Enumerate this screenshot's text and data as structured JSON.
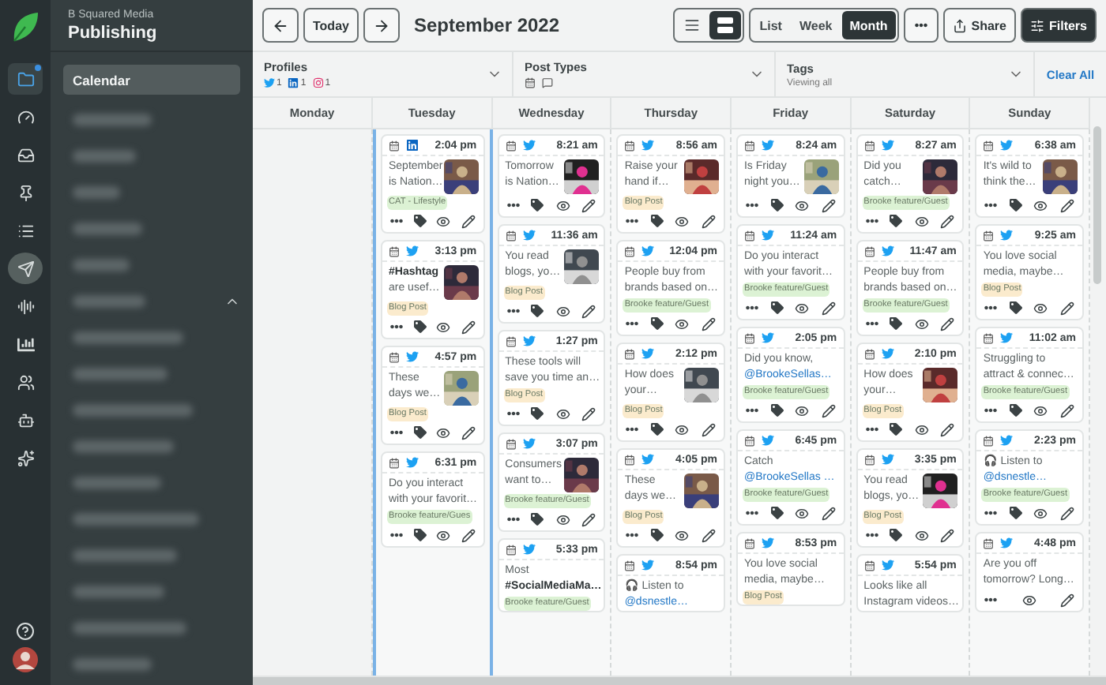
{
  "rail": [
    {
      "kind": "folder",
      "selected": false,
      "badge": true
    },
    {
      "kind": "gauge",
      "selected": false,
      "badge": false
    },
    {
      "kind": "inbox",
      "selected": false,
      "badge": false
    },
    {
      "kind": "pin",
      "selected": false,
      "badge": false
    },
    {
      "kind": "list",
      "selected": false,
      "badge": false
    },
    {
      "kind": "send",
      "selected": true,
      "badge": false
    },
    {
      "kind": "waveform",
      "selected": false,
      "badge": false
    },
    {
      "kind": "chart",
      "selected": false,
      "badge": false
    },
    {
      "kind": "users",
      "selected": false,
      "badge": false
    },
    {
      "kind": "bot",
      "selected": false,
      "badge": false
    },
    {
      "kind": "sparkles",
      "selected": false,
      "badge": false
    }
  ],
  "rail_bottom": [
    {
      "kind": "help"
    },
    {
      "kind": "avatar"
    }
  ],
  "nav": {
    "org": "B Squared Media",
    "section": "Publishing",
    "items": [
      {
        "label": "Calendar",
        "selected": true
      }
    ]
  },
  "toolbar": {
    "today": "Today",
    "title": "September 2022",
    "layouts": [
      {
        "kind": "list",
        "selected": false
      },
      {
        "kind": "grid",
        "selected": true
      }
    ],
    "views": [
      {
        "label": "List",
        "selected": false
      },
      {
        "label": "Week",
        "selected": false
      },
      {
        "label": "Month",
        "selected": true
      }
    ],
    "share": "Share",
    "filters": "Filters"
  },
  "filters": {
    "profiles": {
      "label": "Profiles",
      "networks": [
        {
          "kind": "twitter",
          "count": "1"
        },
        {
          "kind": "linkedin",
          "count": "1"
        },
        {
          "kind": "instagram",
          "count": "1"
        }
      ]
    },
    "post_types": {
      "label": "Post Types"
    },
    "tags": {
      "label": "Tags",
      "value": "Viewing all"
    },
    "clear": "Clear All"
  },
  "days": [
    {
      "name": "Monday",
      "selected": false
    },
    {
      "name": "Tuesday",
      "selected": true,
      "posts": [
        {
          "kind": "linkedin",
          "time": "2:04 pm",
          "lines": [
            {
              "kind": "plain",
              "text": "September"
            },
            {
              "kind": "plain",
              "text": "is Nation…"
            }
          ],
          "picture": true,
          "tag": {
            "label": "CAT - Lifestyle",
            "color": "#dcf2d4"
          },
          "actions": [
            {
              "kind": "more"
            },
            {
              "kind": "tag"
            },
            {
              "kind": "preview"
            },
            {
              "kind": "edit"
            }
          ]
        },
        {
          "kind": "twitter",
          "time": "3:13 pm",
          "lines": [
            {
              "kind": "hashtag",
              "text": "#Hashtag"
            },
            {
              "kind": "plain",
              "text": "are usef…"
            }
          ],
          "picture": true,
          "tag": {
            "label": "Blog Post",
            "color": "#fbebcd"
          },
          "actions": [
            {
              "kind": "more"
            },
            {
              "kind": "tag"
            },
            {
              "kind": "preview"
            },
            {
              "kind": "edit"
            }
          ]
        },
        {
          "kind": "twitter",
          "time": "4:57 pm",
          "lines": [
            {
              "kind": "plain",
              "text": "These"
            },
            {
              "kind": "plain",
              "text": "days we…"
            }
          ],
          "picture": true,
          "tag": {
            "label": "Blog Post",
            "color": "#fbebcd"
          },
          "actions": [
            {
              "kind": "more"
            },
            {
              "kind": "tag"
            },
            {
              "kind": "preview"
            },
            {
              "kind": "edit"
            }
          ]
        },
        {
          "kind": "twitter",
          "time": "6:31 pm",
          "lines": [
            {
              "kind": "plain",
              "text": "Do you interact"
            },
            {
              "kind": "plain",
              "text": "with your favorit…"
            }
          ],
          "picture": false,
          "tag": {
            "label": "Brooke feature/Gues",
            "color": "#dcf2d4"
          },
          "actions": [
            {
              "kind": "more"
            },
            {
              "kind": "tag"
            },
            {
              "kind": "preview"
            },
            {
              "kind": "edit"
            }
          ]
        }
      ]
    },
    {
      "name": "Wednesday",
      "selected": false,
      "posts": [
        {
          "kind": "twitter",
          "time": "8:21 am",
          "lines": [
            {
              "kind": "plain",
              "text": "Tomorrow"
            },
            {
              "kind": "plain",
              "text": "is Nation…"
            }
          ],
          "picture": true,
          "actions": [
            {
              "kind": "more"
            },
            {
              "kind": "tag"
            },
            {
              "kind": "preview"
            },
            {
              "kind": "edit"
            }
          ]
        },
        {
          "kind": "twitter",
          "time": "11:36 am",
          "lines": [
            {
              "kind": "plain",
              "text": "You read"
            },
            {
              "kind": "plain",
              "text": "blogs, yo…"
            }
          ],
          "picture": true,
          "tag": {
            "label": "Blog Post",
            "color": "#fbebcd"
          },
          "actions": [
            {
              "kind": "more"
            },
            {
              "kind": "tag"
            },
            {
              "kind": "preview"
            },
            {
              "kind": "edit"
            }
          ]
        },
        {
          "kind": "twitter",
          "time": "1:27 pm",
          "lines": [
            {
              "kind": "plain",
              "text": "These tools will"
            },
            {
              "kind": "plain",
              "text": "save you time an…"
            }
          ],
          "picture": false,
          "tag": {
            "label": "Blog Post",
            "color": "#fbebcd"
          },
          "actions": [
            {
              "kind": "more"
            },
            {
              "kind": "tag"
            },
            {
              "kind": "preview"
            },
            {
              "kind": "edit"
            }
          ]
        },
        {
          "kind": "twitter",
          "time": "3:07 pm",
          "lines": [
            {
              "kind": "plain",
              "text": "Consumers"
            },
            {
              "kind": "plain",
              "text": "want to…"
            }
          ],
          "picture": true,
          "tag": {
            "label": "Brooke feature/Guest",
            "color": "#dcf2d4"
          },
          "actions": [
            {
              "kind": "more"
            },
            {
              "kind": "tag"
            },
            {
              "kind": "preview"
            },
            {
              "kind": "edit"
            }
          ]
        },
        {
          "kind": "twitter",
          "time": "5:33 pm",
          "lines": [
            {
              "kind": "plain",
              "text": "Most"
            },
            {
              "kind": "hashtag",
              "text": "#SocialMediaMa…"
            }
          ],
          "picture": false,
          "tag": {
            "label": "Brooke feature/Guest",
            "color": "#dcf2d4"
          }
        }
      ]
    },
    {
      "name": "Thursday",
      "selected": false,
      "posts": [
        {
          "kind": "twitter",
          "time": "8:56 am",
          "lines": [
            {
              "kind": "plain",
              "text": "Raise your"
            },
            {
              "kind": "plain",
              "text": "hand if…"
            }
          ],
          "picture": true,
          "tag": {
            "label": "Blog Post",
            "color": "#fbebcd"
          },
          "actions": [
            {
              "kind": "more"
            },
            {
              "kind": "tag"
            },
            {
              "kind": "preview"
            },
            {
              "kind": "edit"
            }
          ]
        },
        {
          "kind": "twitter",
          "time": "12:04 pm",
          "lines": [
            {
              "kind": "plain",
              "text": "People buy from"
            },
            {
              "kind": "plain",
              "text": "brands based on…"
            }
          ],
          "picture": false,
          "tag": {
            "label": "Brooke feature/Guest",
            "color": "#dcf2d4"
          },
          "actions": [
            {
              "kind": "more"
            },
            {
              "kind": "tag"
            },
            {
              "kind": "preview"
            },
            {
              "kind": "edit"
            }
          ]
        },
        {
          "kind": "twitter",
          "time": "2:12 pm",
          "lines": [
            {
              "kind": "plain",
              "text": "How does"
            },
            {
              "kind": "plain",
              "text": "your…"
            }
          ],
          "picture": true,
          "tag": {
            "label": "Blog Post",
            "color": "#fbebcd"
          },
          "actions": [
            {
              "kind": "more"
            },
            {
              "kind": "tag"
            },
            {
              "kind": "preview"
            },
            {
              "kind": "edit"
            }
          ]
        },
        {
          "kind": "twitter",
          "time": "4:05 pm",
          "lines": [
            {
              "kind": "plain",
              "text": "These"
            },
            {
              "kind": "plain",
              "text": "days we…"
            }
          ],
          "picture": true,
          "tag": {
            "label": "Blog Post",
            "color": "#fbebcd"
          },
          "actions": [
            {
              "kind": "more"
            },
            {
              "kind": "tag"
            },
            {
              "kind": "preview"
            },
            {
              "kind": "edit"
            }
          ]
        },
        {
          "kind": "twitter",
          "time": "8:54 pm",
          "lines": [
            {
              "kind": "plain",
              "text": "🎧 Listen to"
            },
            {
              "kind": "mention",
              "text": "@dsnestle…"
            }
          ],
          "picture": false
        }
      ]
    },
    {
      "name": "Friday",
      "selected": false,
      "posts": [
        {
          "kind": "twitter",
          "time": "8:24 am",
          "lines": [
            {
              "kind": "plain",
              "text": "Is Friday"
            },
            {
              "kind": "plain",
              "text": "night you…"
            }
          ],
          "picture": true,
          "actions": [
            {
              "kind": "more"
            },
            {
              "kind": "tag"
            },
            {
              "kind": "preview"
            },
            {
              "kind": "edit"
            }
          ]
        },
        {
          "kind": "twitter",
          "time": "11:24 am",
          "lines": [
            {
              "kind": "plain",
              "text": "Do you interact"
            },
            {
              "kind": "plain",
              "text": "with your favorit…"
            }
          ],
          "picture": false,
          "tag": {
            "label": "Brooke feature/Guest",
            "color": "#dcf2d4"
          },
          "actions": [
            {
              "kind": "more"
            },
            {
              "kind": "tag"
            },
            {
              "kind": "preview"
            },
            {
              "kind": "edit"
            }
          ]
        },
        {
          "kind": "twitter",
          "time": "2:05 pm",
          "lines": [
            {
              "kind": "plain",
              "text": "Did you know,"
            },
            {
              "kind": "mention",
              "text": "@BrookeSellas…"
            }
          ],
          "picture": false,
          "tag": {
            "label": "Brooke feature/Guest",
            "color": "#dcf2d4"
          },
          "actions": [
            {
              "kind": "more"
            },
            {
              "kind": "tag"
            },
            {
              "kind": "preview"
            },
            {
              "kind": "edit"
            }
          ]
        },
        {
          "kind": "twitter",
          "time": "6:45 pm",
          "lines": [
            {
              "kind": "plain",
              "text": "Catch"
            },
            {
              "kind": "mention",
              "text": "@BrookeSellas …"
            }
          ],
          "picture": false,
          "tag": {
            "label": "Brooke feature/Guest",
            "color": "#dcf2d4"
          },
          "actions": [
            {
              "kind": "more"
            },
            {
              "kind": "tag"
            },
            {
              "kind": "preview"
            },
            {
              "kind": "edit"
            }
          ]
        },
        {
          "kind": "twitter",
          "time": "8:53 pm",
          "lines": [
            {
              "kind": "plain",
              "text": "You love social"
            },
            {
              "kind": "plain",
              "text": "media, maybe…"
            }
          ],
          "picture": false,
          "tag": {
            "label": "Blog Post",
            "color": "#fbebcd"
          }
        }
      ]
    },
    {
      "name": "Saturday",
      "selected": false,
      "posts": [
        {
          "kind": "twitter",
          "time": "8:27 am",
          "lines": [
            {
              "kind": "plain",
              "text": "Did you"
            },
            {
              "kind": "plain",
              "text": "catch…"
            }
          ],
          "picture": true,
          "tag": {
            "label": "Brooke feature/Guest",
            "color": "#dcf2d4"
          },
          "actions": [
            {
              "kind": "more"
            },
            {
              "kind": "tag"
            },
            {
              "kind": "preview"
            },
            {
              "kind": "edit"
            }
          ]
        },
        {
          "kind": "twitter",
          "time": "11:47 am",
          "lines": [
            {
              "kind": "plain",
              "text": "People buy from"
            },
            {
              "kind": "plain",
              "text": "brands based on…"
            }
          ],
          "picture": false,
          "tag": {
            "label": "Brooke feature/Guest",
            "color": "#dcf2d4"
          },
          "actions": [
            {
              "kind": "more"
            },
            {
              "kind": "tag"
            },
            {
              "kind": "preview"
            },
            {
              "kind": "edit"
            }
          ]
        },
        {
          "kind": "twitter",
          "time": "2:10 pm",
          "lines": [
            {
              "kind": "plain",
              "text": "How does"
            },
            {
              "kind": "plain",
              "text": "your…"
            }
          ],
          "picture": true,
          "tag": {
            "label": "Blog Post",
            "color": "#fbebcd"
          },
          "actions": [
            {
              "kind": "more"
            },
            {
              "kind": "tag"
            },
            {
              "kind": "preview"
            },
            {
              "kind": "edit"
            }
          ]
        },
        {
          "kind": "twitter",
          "time": "3:35 pm",
          "lines": [
            {
              "kind": "plain",
              "text": "You read"
            },
            {
              "kind": "plain",
              "text": "blogs, yo…"
            }
          ],
          "picture": true,
          "tag": {
            "label": "Blog Post",
            "color": "#fbebcd"
          },
          "actions": [
            {
              "kind": "more"
            },
            {
              "kind": "tag"
            },
            {
              "kind": "preview"
            },
            {
              "kind": "edit"
            }
          ]
        },
        {
          "kind": "twitter",
          "time": "5:54 pm",
          "lines": [
            {
              "kind": "plain",
              "text": "Looks like all"
            },
            {
              "kind": "plain",
              "text": "Instagram videos…"
            }
          ],
          "picture": false
        }
      ]
    },
    {
      "name": "Sunday",
      "selected": false,
      "posts": [
        {
          "kind": "twitter",
          "time": "6:38 am",
          "lines": [
            {
              "kind": "plain",
              "text": "It's wild to"
            },
            {
              "kind": "plain",
              "text": "think the…"
            }
          ],
          "picture": true,
          "actions": [
            {
              "kind": "more"
            },
            {
              "kind": "tag"
            },
            {
              "kind": "preview"
            },
            {
              "kind": "edit"
            }
          ]
        },
        {
          "kind": "twitter",
          "time": "9:25 am",
          "lines": [
            {
              "kind": "plain",
              "text": "You love social"
            },
            {
              "kind": "plain",
              "text": "media, maybe…"
            }
          ],
          "picture": false,
          "tag": {
            "label": "Blog Post",
            "color": "#fbebcd"
          },
          "actions": [
            {
              "kind": "more"
            },
            {
              "kind": "tag"
            },
            {
              "kind": "preview"
            },
            {
              "kind": "edit"
            }
          ]
        },
        {
          "kind": "twitter",
          "time": "11:02 am",
          "lines": [
            {
              "kind": "plain",
              "text": "Struggling to"
            },
            {
              "kind": "plain",
              "text": "attract & connec…"
            }
          ],
          "picture": false,
          "tag": {
            "label": "Brooke feature/Guest",
            "color": "#dcf2d4"
          },
          "actions": [
            {
              "kind": "more"
            },
            {
              "kind": "tag"
            },
            {
              "kind": "preview"
            },
            {
              "kind": "edit"
            }
          ]
        },
        {
          "kind": "twitter",
          "time": "2:23 pm",
          "lines": [
            {
              "kind": "plain",
              "text": "🎧 Listen to"
            },
            {
              "kind": "mention",
              "text": "@dsnestle…"
            }
          ],
          "picture": false,
          "tag": {
            "label": "Brooke feature/Guest",
            "color": "#dcf2d4"
          },
          "actions": [
            {
              "kind": "more"
            },
            {
              "kind": "tag"
            },
            {
              "kind": "preview"
            },
            {
              "kind": "edit"
            }
          ]
        },
        {
          "kind": "twitter",
          "time": "4:48 pm",
          "lines": [
            {
              "kind": "plain",
              "text": "Are you off"
            },
            {
              "kind": "plain",
              "text": "tomorrow? Long…"
            }
          ],
          "picture": false,
          "actions": [
            {
              "kind": "more"
            },
            {
              "kind": "preview"
            },
            {
              "kind": "edit"
            }
          ]
        }
      ]
    }
  ]
}
